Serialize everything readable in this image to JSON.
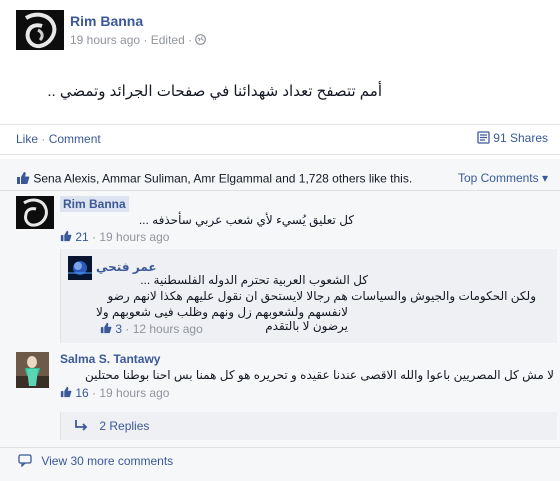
{
  "post": {
    "author": "Rim Banna",
    "time": "19 hours ago",
    "edited": "· Edited ·",
    "text": "أمم تتصفح تعداد شهدائنا في صفحات الجرائد وتمضي ..",
    "actions": {
      "like": "Like",
      "separator": "·",
      "comment": "Comment"
    },
    "shares": "91 Shares"
  },
  "likes": {
    "text": "Sena Alexis, Ammar Suliman, Amr Elgammal and 1,728 others like this.",
    "top_comments": "Top Comments ▾"
  },
  "comments": [
    {
      "author": "Rim Banna",
      "text": "كل تعليق يُسيء لأي شعب عربي سأحذفه ...",
      "likes": "21",
      "time": "· 19 hours ago"
    },
    {
      "author": "عمر فتحي",
      "text_lines": [
        "كل الشعوب العربية تحترم الدوله الفلسطنية ...",
        "ولكن الحكومات والجيوش والسياسات هم رجالا لايستحق ان نقول عليهم هكذا لانهم رضو",
        "لانفسهم ولشعوبهم زل ونهم وظلب فيى شعوبهم ولا يرضون لا بالتقدم"
      ],
      "likes": "3",
      "time": "· 12 hours ago"
    },
    {
      "author": "Salma S. Tantawy",
      "text": "لا مش كل المصريين باعوا والله الاقصى عندنا عقيده و تحريره هو كل همنا بس احنا بوطنا محتلين",
      "likes": "16",
      "time": "· 19 hours ago"
    }
  ],
  "replies_link": "2 Replies",
  "view_more": "View 30 more comments",
  "colors": {
    "link": "#3b5998",
    "meta": "#90949c",
    "background_comments": "#f6f7f9"
  }
}
